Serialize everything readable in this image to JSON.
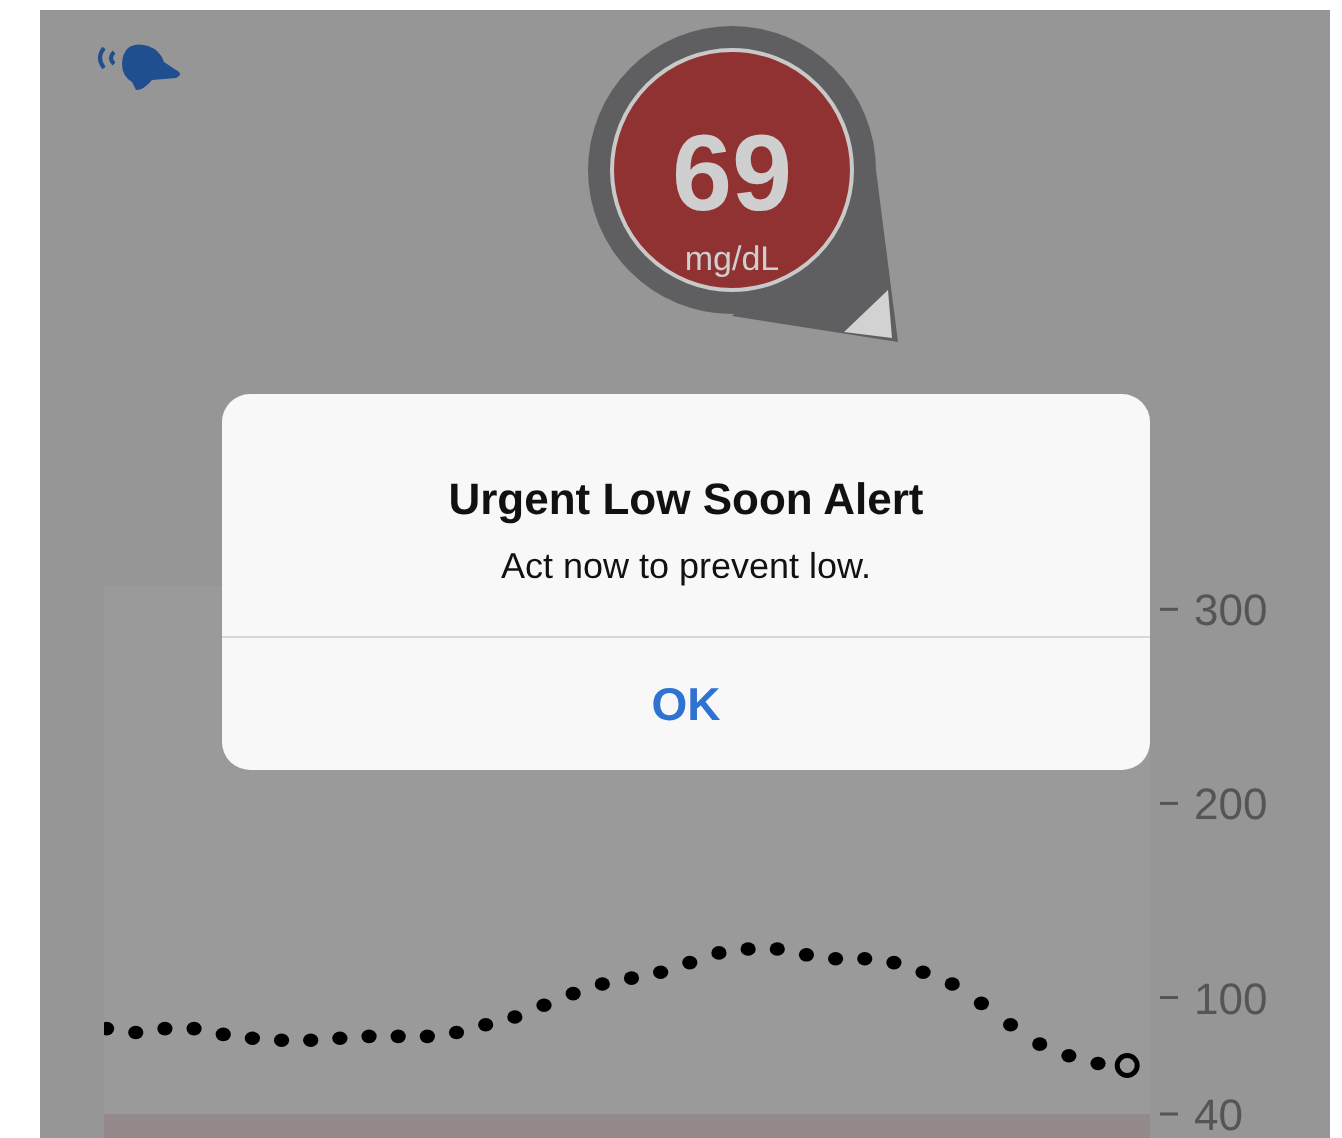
{
  "glucose": {
    "value": "69",
    "unit": "mg/dL"
  },
  "alert": {
    "title": "Urgent Low Soon Alert",
    "message": "Act now to prevent low.",
    "buttons": [
      {
        "label": "OK"
      }
    ]
  },
  "chart": {
    "y_axis_labels": [
      "300",
      "200",
      "100",
      "40"
    ]
  }
}
